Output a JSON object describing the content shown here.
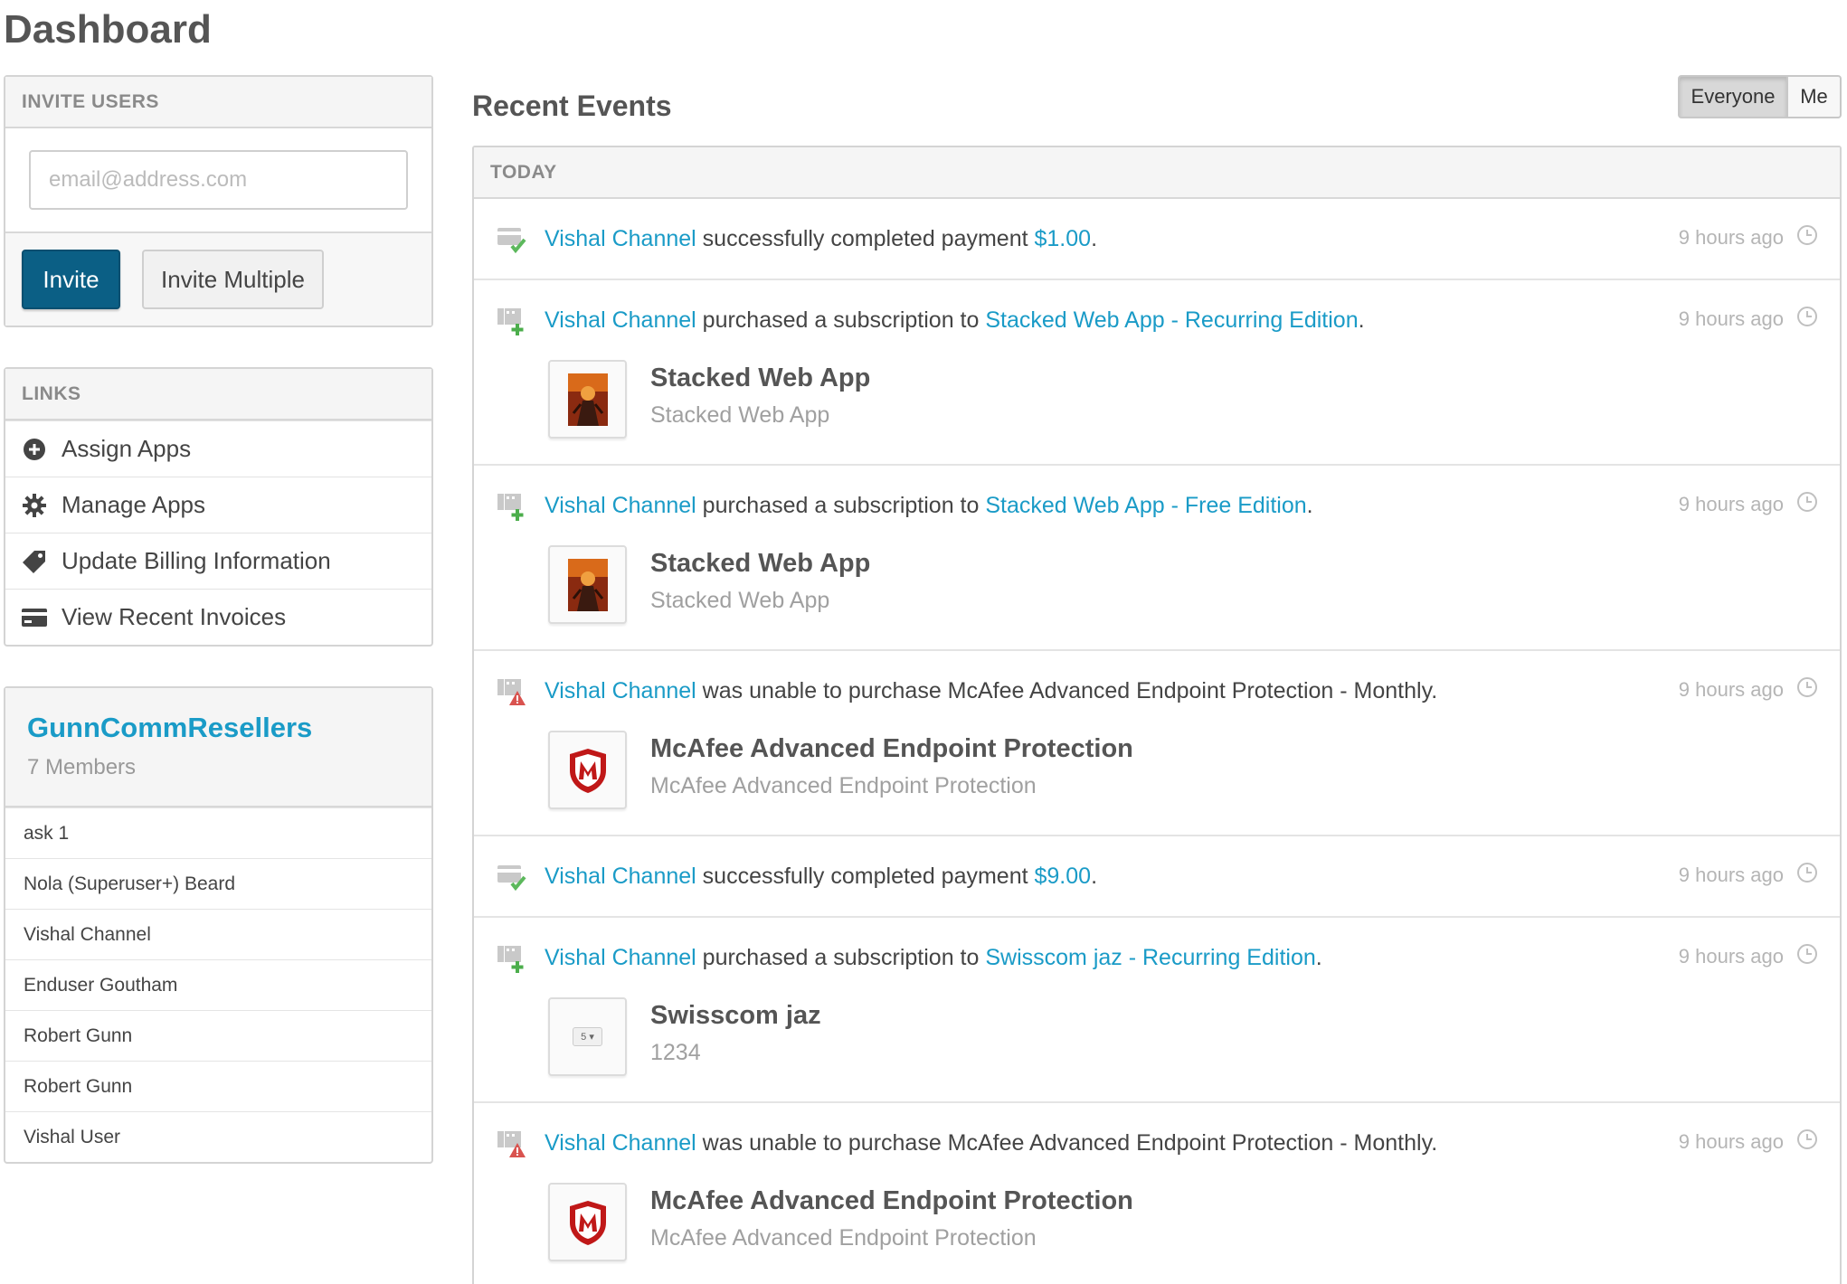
{
  "page": {
    "title": "Dashboard"
  },
  "invite": {
    "heading": "INVITE USERS",
    "email_placeholder": "email@address.com",
    "invite_label": "Invite",
    "invite_multiple_label": "Invite Multiple"
  },
  "links": {
    "heading": "LINKS",
    "items": [
      {
        "label": "Assign Apps",
        "icon": "plus-circle-icon"
      },
      {
        "label": "Manage Apps",
        "icon": "gear-icon"
      },
      {
        "label": "Update Billing Information",
        "icon": "tag-icon"
      },
      {
        "label": "View Recent Invoices",
        "icon": "credit-card-icon"
      }
    ]
  },
  "group": {
    "name": "GunnCommResellers",
    "count": "7 Members",
    "members": [
      "ask 1",
      "Nola (Superuser+) Beard",
      "Vishal Channel",
      "Enduser Goutham",
      "Robert Gunn",
      "Robert Gunn",
      "Vishal User"
    ]
  },
  "events": {
    "title": "Recent Events",
    "filter": {
      "everyone": "Everyone",
      "me": "Me",
      "selected": "Everyone"
    },
    "section": "TODAY",
    "items": [
      {
        "type": "payment",
        "user": "Vishal Channel",
        "text": " successfully completed payment ",
        "link": "$1.00",
        "suffix": ".",
        "time": "9 hours ago"
      },
      {
        "type": "subscription",
        "user": "Vishal Channel",
        "text": " purchased a subscription to ",
        "link": "Stacked Web App - Recurring Edition",
        "suffix": ".",
        "time": "9 hours ago",
        "product": {
          "title": "Stacked Web App",
          "subtitle": "Stacked Web App"
        }
      },
      {
        "type": "subscription",
        "user": "Vishal Channel",
        "text": " purchased a subscription to ",
        "link": "Stacked Web App - Free Edition",
        "suffix": ".",
        "time": "9 hours ago",
        "product": {
          "title": "Stacked Web App",
          "subtitle": "Stacked Web App"
        }
      },
      {
        "type": "failure",
        "user": "Vishal Channel",
        "text": " was unable to purchase McAfee Advanced Endpoint Protection - Monthly.",
        "time": "9 hours ago",
        "product": {
          "title": "McAfee Advanced Endpoint Protection",
          "subtitle": "McAfee Advanced Endpoint Protection"
        }
      },
      {
        "type": "payment",
        "user": "Vishal Channel",
        "text": " successfully completed payment ",
        "link": "$9.00",
        "suffix": ".",
        "time": "9 hours ago"
      },
      {
        "type": "subscription",
        "user": "Vishal Channel",
        "text": " purchased a subscription to ",
        "link": "Swisscom jaz - Recurring Edition",
        "suffix": ".",
        "time": "9 hours ago",
        "product": {
          "title": "Swisscom jaz",
          "subtitle": "1234",
          "thumb_text": "5 ▾"
        }
      },
      {
        "type": "failure",
        "user": "Vishal Channel",
        "text": " was unable to purchase McAfee Advanced Endpoint Protection - Monthly.",
        "time": "9 hours ago",
        "product": {
          "title": "McAfee Advanced Endpoint Protection",
          "subtitle": "McAfee Advanced Endpoint Protection"
        }
      }
    ]
  },
  "colors": {
    "link": "#1a9bc7",
    "primary_button": "#0b5f85",
    "success": "#5cb85c",
    "error": "#d9534f",
    "add": "#4cae4c"
  }
}
